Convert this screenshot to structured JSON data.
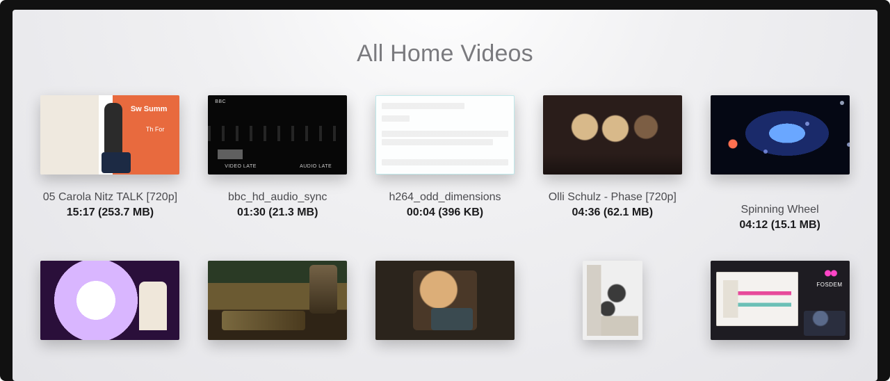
{
  "title": "All Home Videos",
  "videos": [
    {
      "name": "05   Carola Nitz   TALK   [720p]",
      "duration": "15:17",
      "size": "253.7 MB"
    },
    {
      "name": "bbc_hd_audio_sync",
      "duration": "01:30",
      "size": "21.3 MB"
    },
    {
      "name": "h264_odd_dimensions",
      "duration": "00:04",
      "size": "396 KB"
    },
    {
      "name": "Olli Schulz - Phase [720p]",
      "duration": "04:36",
      "size": "62.1 MB"
    },
    {
      "name": "Spinning Wheel",
      "duration": "04:12",
      "size": "15.1 MB"
    },
    {
      "name": "",
      "duration": "",
      "size": ""
    },
    {
      "name": "",
      "duration": "",
      "size": ""
    },
    {
      "name": "",
      "duration": "",
      "size": ""
    },
    {
      "name": "",
      "duration": "",
      "size": ""
    },
    {
      "name": "",
      "duration": "",
      "size": ""
    }
  ],
  "thumb_text": {
    "t0_tag": "Sw     Summ",
    "t0_tag2": "Th\nFor",
    "t1_bbc": "BBC",
    "t1_l": "VIDEO LATE",
    "t1_r": "AUDIO LATE",
    "t9_fosdem": "FOSDEM"
  }
}
